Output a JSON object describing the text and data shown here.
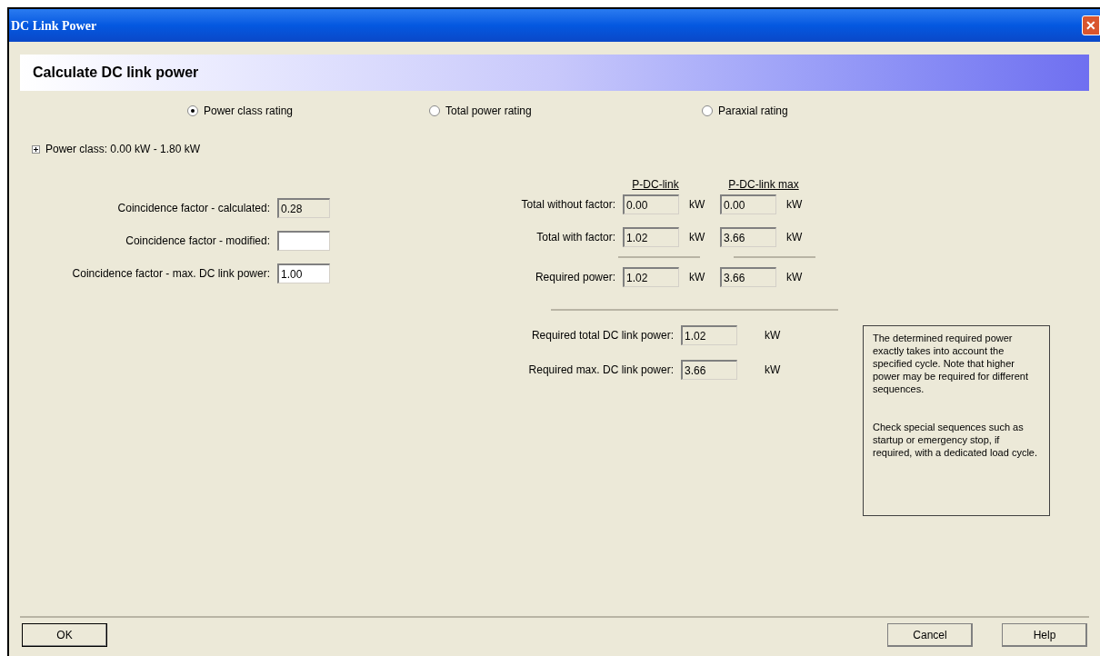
{
  "window": {
    "title": "DC Link Power",
    "close": "✕"
  },
  "heading": "Calculate DC link power",
  "rating_options": [
    {
      "label": "Power class rating",
      "selected": true
    },
    {
      "label": "Total power rating",
      "selected": false
    },
    {
      "label": "Paraxial rating",
      "selected": false
    }
  ],
  "power_class": {
    "label": "Power class: 0.00 kW - 1.80 kW",
    "expanded": false
  },
  "coincidence_fields": [
    {
      "label": "Coincidence factor - calculated:",
      "value": "0.28",
      "disabled": true
    },
    {
      "label": "Coincidence factor - modified:",
      "disabled": false
    },
    {
      "label": "Coincidence factor - max. DC link power:",
      "value": "1.00",
      "disabled": false
    }
  ],
  "power_table": {
    "columns": [
      "P-DC-link",
      "P-DC-link max"
    ],
    "rows": [
      {
        "label": "Total without factor:",
        "cells": [
          {
            "value": "0.00",
            "unit": "kW"
          },
          {
            "value": "0.00",
            "unit": "kW"
          }
        ]
      },
      {
        "label": "Total with factor:",
        "cells": [
          {
            "value": "1.02",
            "unit": "kW"
          },
          {
            "value": "3.66",
            "unit": "kW"
          }
        ]
      },
      {
        "label": "Required power:",
        "cells": [
          {
            "value": "1.02",
            "unit": "kW"
          },
          {
            "value": "3.66",
            "unit": "kW"
          }
        ]
      }
    ]
  },
  "required_totals": [
    {
      "label": "Required total DC link power:",
      "value": "1.02",
      "unit": "kW"
    },
    {
      "label": "Required max. DC link power:",
      "value": "3.66",
      "unit": "kW"
    }
  ],
  "note": [
    "The determined required power exactly takes into account the specified cycle. Note that higher power may be required for different sequences.",
    "Check special sequences such as startup or emergency stop, if required, with a dedicated load cycle."
  ],
  "buttons": {
    "ok": "OK",
    "cancel": "Cancel",
    "help": "Help"
  }
}
